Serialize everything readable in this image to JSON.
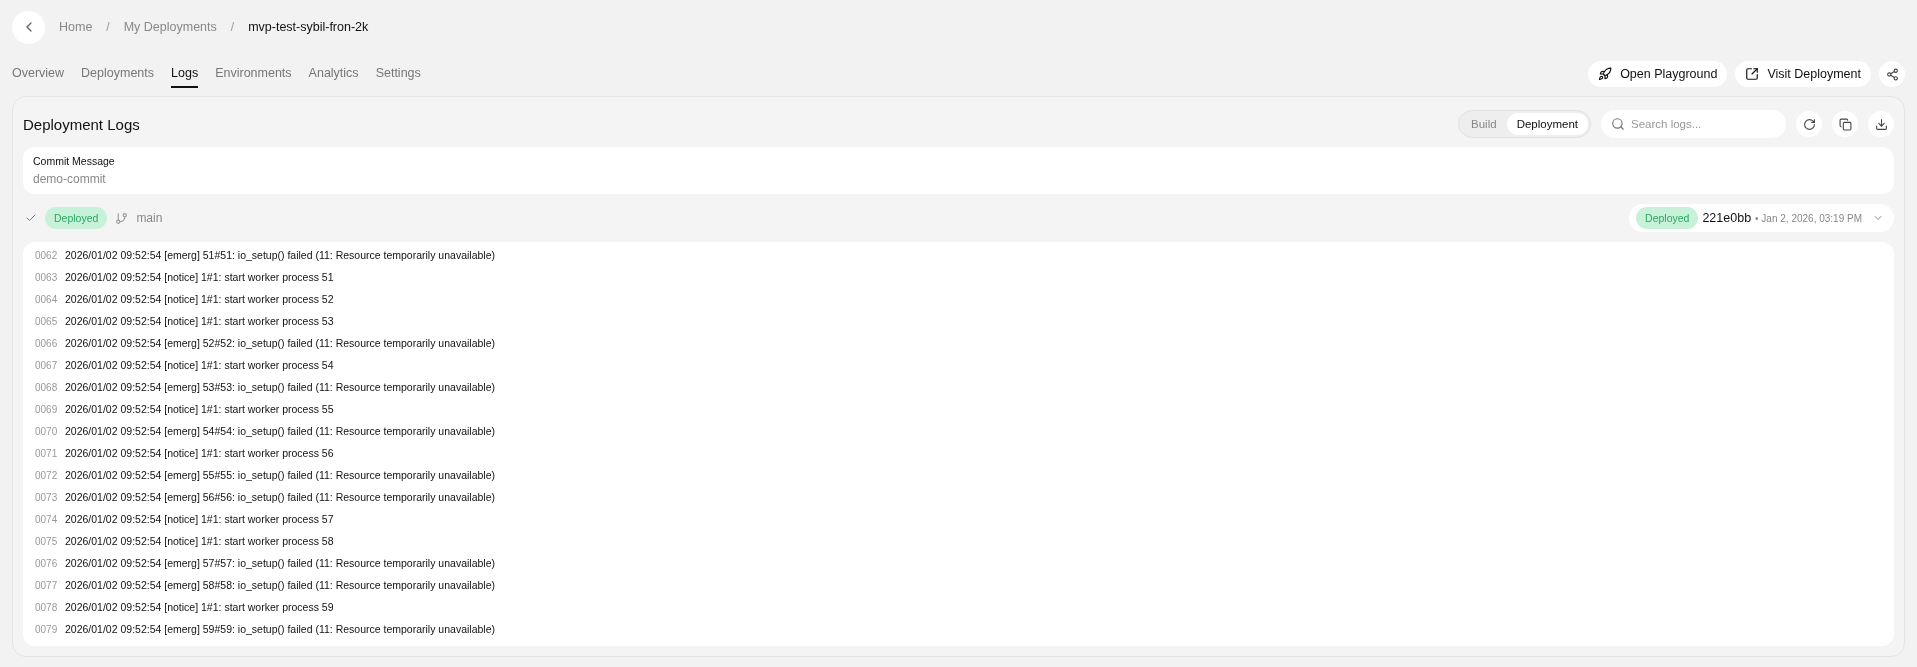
{
  "breadcrumb": [
    "Home",
    "My Deployments",
    "mvp-test-sybil-fron-2k"
  ],
  "breadcrumb_separator": "/",
  "tabs": [
    {
      "label": "Overview",
      "selected": false
    },
    {
      "label": "Deployments",
      "selected": false
    },
    {
      "label": "Logs",
      "selected": true
    },
    {
      "label": "Environments",
      "selected": false
    },
    {
      "label": "Analytics",
      "selected": false
    },
    {
      "label": "Settings",
      "selected": false
    }
  ],
  "actions": [
    "Open Playground",
    "Visit Deployment"
  ],
  "panel": {
    "title": "Deployment Logs",
    "log_source": [
      {
        "label": "Build",
        "selected": false
      },
      {
        "label": "Deployment",
        "selected": true
      }
    ],
    "search": {
      "placeholder": "Search logs..."
    },
    "commit": {
      "label": "Commit Message",
      "value": "demo-commit"
    },
    "status": {
      "badge": "Deployed",
      "branch": "main"
    },
    "deployment": {
      "badge": "Deployed",
      "hash": "221e0bb",
      "date": "• Jan 2, 2026, 03:19 PM"
    },
    "logs": [
      {
        "line": "0062",
        "text": "2026/01/02 09:52:54 [emerg] 51#51: io_setup() failed (11: Resource temporarily unavailable)"
      },
      {
        "line": "0063",
        "text": "2026/01/02 09:52:54 [notice] 1#1: start worker process 51"
      },
      {
        "line": "0064",
        "text": "2026/01/02 09:52:54 [notice] 1#1: start worker process 52"
      },
      {
        "line": "0065",
        "text": "2026/01/02 09:52:54 [notice] 1#1: start worker process 53"
      },
      {
        "line": "0066",
        "text": "2026/01/02 09:52:54 [emerg] 52#52: io_setup() failed (11: Resource temporarily unavailable)"
      },
      {
        "line": "0067",
        "text": "2026/01/02 09:52:54 [notice] 1#1: start worker process 54"
      },
      {
        "line": "0068",
        "text": "2026/01/02 09:52:54 [emerg] 53#53: io_setup() failed (11: Resource temporarily unavailable)"
      },
      {
        "line": "0069",
        "text": "2026/01/02 09:52:54 [notice] 1#1: start worker process 55"
      },
      {
        "line": "0070",
        "text": "2026/01/02 09:52:54 [emerg] 54#54: io_setup() failed (11: Resource temporarily unavailable)"
      },
      {
        "line": "0071",
        "text": "2026/01/02 09:52:54 [notice] 1#1: start worker process 56"
      },
      {
        "line": "0072",
        "text": "2026/01/02 09:52:54 [emerg] 55#55: io_setup() failed (11: Resource temporarily unavailable)"
      },
      {
        "line": "0073",
        "text": "2026/01/02 09:52:54 [emerg] 56#56: io_setup() failed (11: Resource temporarily unavailable)"
      },
      {
        "line": "0074",
        "text": "2026/01/02 09:52:54 [notice] 1#1: start worker process 57"
      },
      {
        "line": "0075",
        "text": "2026/01/02 09:52:54 [notice] 1#1: start worker process 58"
      },
      {
        "line": "0076",
        "text": "2026/01/02 09:52:54 [emerg] 57#57: io_setup() failed (11: Resource temporarily unavailable)"
      },
      {
        "line": "0077",
        "text": "2026/01/02 09:52:54 [emerg] 58#58: io_setup() failed (11: Resource temporarily unavailable)"
      },
      {
        "line": "0078",
        "text": "2026/01/02 09:52:54 [notice] 1#1: start worker process 59"
      },
      {
        "line": "0079",
        "text": "2026/01/02 09:52:54 [emerg] 59#59: io_setup() failed (11: Resource temporarily unavailable)"
      }
    ]
  }
}
